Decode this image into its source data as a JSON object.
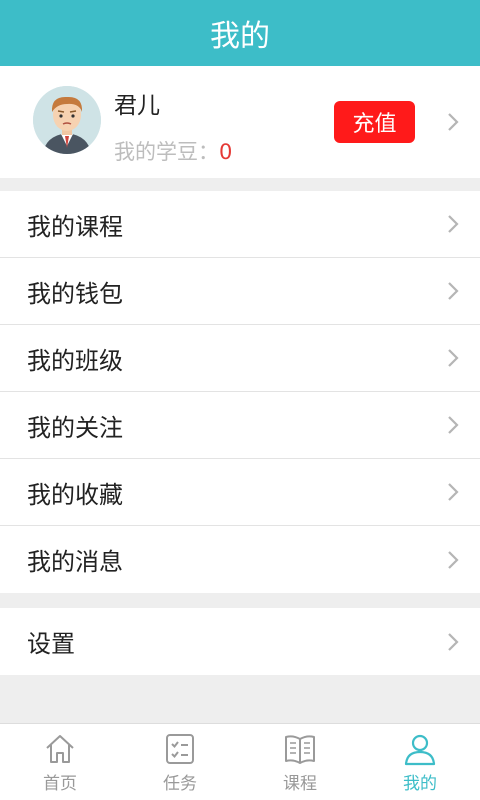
{
  "header": {
    "title": "我的"
  },
  "profile": {
    "username": "君儿",
    "beans_label": "我的学豆：",
    "beans_value": "0",
    "recharge_label": "充值"
  },
  "menu": {
    "items": [
      {
        "label": "我的课程"
      },
      {
        "label": "我的钱包"
      },
      {
        "label": "我的班级"
      },
      {
        "label": "我的关注"
      },
      {
        "label": "我的收藏"
      },
      {
        "label": "我的消息"
      }
    ],
    "settings_label": "设置"
  },
  "tabbar": {
    "tabs": [
      {
        "label": "首页",
        "icon": "home-icon"
      },
      {
        "label": "任务",
        "icon": "task-icon"
      },
      {
        "label": "课程",
        "icon": "book-icon"
      },
      {
        "label": "我的",
        "icon": "user-icon"
      }
    ],
    "active": "我的"
  },
  "colors": {
    "accent": "#3dbdc8",
    "recharge": "#ff1a1a",
    "beans_value": "#e53935"
  }
}
